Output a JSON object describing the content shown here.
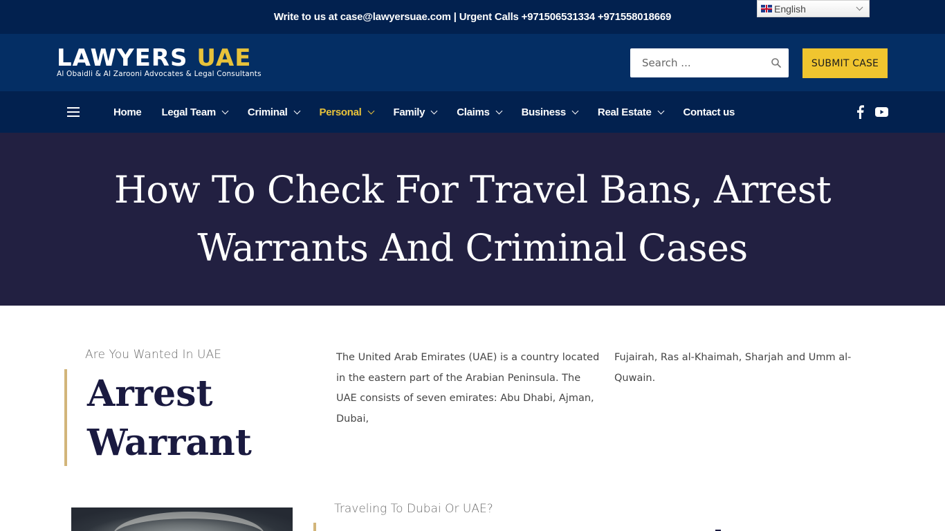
{
  "topbar": {
    "contact_text": "Write to us at case@lawyersuae.com | Urgent Calls +971506531334 +971558018669",
    "language": {
      "selected": "English",
      "flag_icon": "uk-flag-icon"
    }
  },
  "header": {
    "logo": {
      "main_white": "LAWYERS",
      "main_accent": "UAE",
      "tagline": "Al Obaidli & Al Zarooni Advocates & Legal Consultants"
    },
    "search": {
      "placeholder": "Search ...",
      "value": "",
      "icon": "search-icon"
    },
    "submit_button": "SUBMIT CASE"
  },
  "nav": {
    "menu_icon": "hamburger-icon",
    "items": [
      {
        "label": "Home",
        "has_dropdown": false,
        "active": false
      },
      {
        "label": "Legal Team",
        "has_dropdown": true,
        "active": false
      },
      {
        "label": "Criminal",
        "has_dropdown": true,
        "active": false
      },
      {
        "label": "Personal",
        "has_dropdown": true,
        "active": true
      },
      {
        "label": "Family",
        "has_dropdown": true,
        "active": false
      },
      {
        "label": "Claims",
        "has_dropdown": true,
        "active": false
      },
      {
        "label": "Business",
        "has_dropdown": true,
        "active": false
      },
      {
        "label": "Real Estate",
        "has_dropdown": true,
        "active": false
      },
      {
        "label": "Contact us",
        "has_dropdown": false,
        "active": false
      }
    ],
    "social": [
      "facebook-icon",
      "youtube-icon"
    ]
  },
  "hero": {
    "title": "How To Check For Travel Bans, Arrest Warrants And Criminal Cases"
  },
  "section1": {
    "kicker": "Are You Wanted In UAE",
    "title": "Arrest Warrant",
    "paragraph_col1": "The United Arab Emirates (UAE) is a country located in the eastern part of the Arabian Peninsula. The UAE consists of seven emirates: Abu Dhabi, Ajman, Dubai,",
    "paragraph_col2": "Fujairah, Ras al-Khaimah, Sharjah and Umm al-Quwain."
  },
  "section2": {
    "kicker": "Traveling To Dubai Or UAE?"
  },
  "colors": {
    "topbar_bg": "#02214f",
    "header_bg": "#042e64",
    "nav_bg": "#02214f",
    "hero_bg": "#222041",
    "accent_gold": "#e8c23a",
    "button_yellow": "#f0c52f",
    "divider_gold": "#d2b57a",
    "heading_navy": "#1a1a40"
  }
}
